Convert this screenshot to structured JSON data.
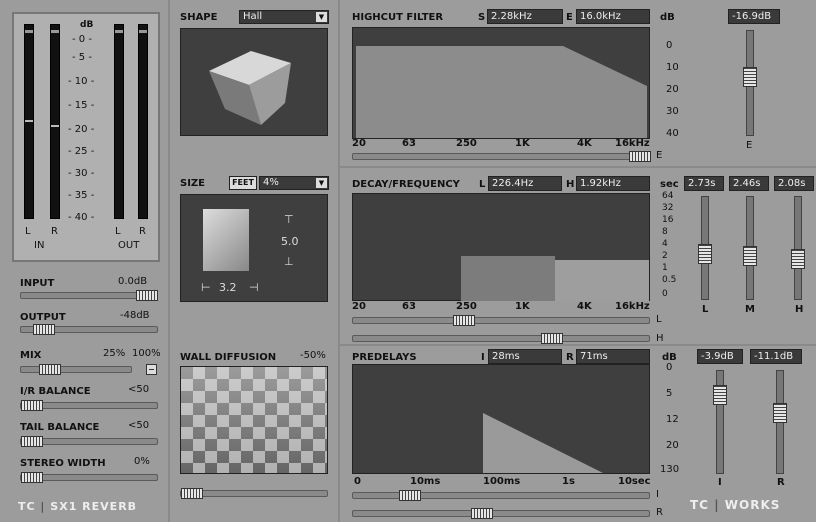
{
  "meters": {
    "db_label": "dB",
    "scale": [
      "- 0 -",
      "- 5 -",
      "- 10 -",
      "- 15 -",
      "- 20 -",
      "- 25 -",
      "- 30 -",
      "- 35 -",
      "- 40 -"
    ],
    "in_l": "L",
    "in_r": "R",
    "in_label": "IN",
    "out_l": "L",
    "out_r": "R",
    "out_label": "OUT"
  },
  "left": {
    "input_label": "INPUT",
    "input_value": "0.0dB",
    "output_label": "OUTPUT",
    "output_value": "-48dB",
    "mix_label": "MIX",
    "mix_value": "25%",
    "mix_100": "100%",
    "ir_label": "I/R BALANCE",
    "ir_value": "<50",
    "tail_label": "TAIL BALANCE",
    "tail_value": "<50",
    "stereo_label": "STEREO WIDTH",
    "stereo_value": "0%",
    "brand_tc": "TC",
    "brand_product": "SX1 REVERB"
  },
  "shape": {
    "label": "SHAPE",
    "selected": "Hall"
  },
  "size": {
    "label": "SIZE",
    "unit": "FEET",
    "selected": "4%",
    "height": "5.0",
    "width": "3.2"
  },
  "wall": {
    "label": "WALL DIFFUSION",
    "value": "-50%"
  },
  "highcut": {
    "label": "HIGHCUT FILTER",
    "s_label": "S",
    "s_value": "2.28kHz",
    "e_label": "E",
    "e_value": "16.0kHz",
    "db_label": "dB",
    "db_ticks": [
      "0",
      "10",
      "20",
      "30",
      "40"
    ],
    "freq_ticks": [
      "20",
      "63",
      "250",
      "1K",
      "4K",
      "16kHz"
    ],
    "slider_e": "E",
    "gain_value": "-16.9dB",
    "gain_label": "E"
  },
  "decay": {
    "label": "DECAY/FREQUENCY",
    "l_label": "L",
    "l_value": "226.4Hz",
    "h_label": "H",
    "h_value": "1.92kHz",
    "sec_label": "sec",
    "time_ticks": [
      "64",
      "32",
      "16",
      "8",
      "4",
      "2",
      "1",
      "0.5",
      "0"
    ],
    "freq_ticks": [
      "20",
      "63",
      "250",
      "1K",
      "4K",
      "16kHz"
    ],
    "slider_l": "L",
    "slider_h": "H",
    "vals": [
      "2.73s",
      "2.46s",
      "2.08s"
    ],
    "vlabels": [
      "L",
      "M",
      "H"
    ]
  },
  "predelay": {
    "label": "PREDELAYS",
    "i_label": "I",
    "i_value": "28ms",
    "r_label": "R",
    "r_value": "71ms",
    "db_label": "dB",
    "db_ticks": [
      "0",
      "5",
      "12",
      "20",
      "130"
    ],
    "time_ticks": [
      "0",
      "10ms",
      "100ms",
      "1s",
      "10sec"
    ],
    "slider_i": "I",
    "slider_r": "R",
    "vals": [
      "-3.9dB",
      "-11.1dB"
    ],
    "vlabels": [
      "I",
      "R"
    ],
    "brand_tc": "TC",
    "brand_works": "WORKS"
  }
}
